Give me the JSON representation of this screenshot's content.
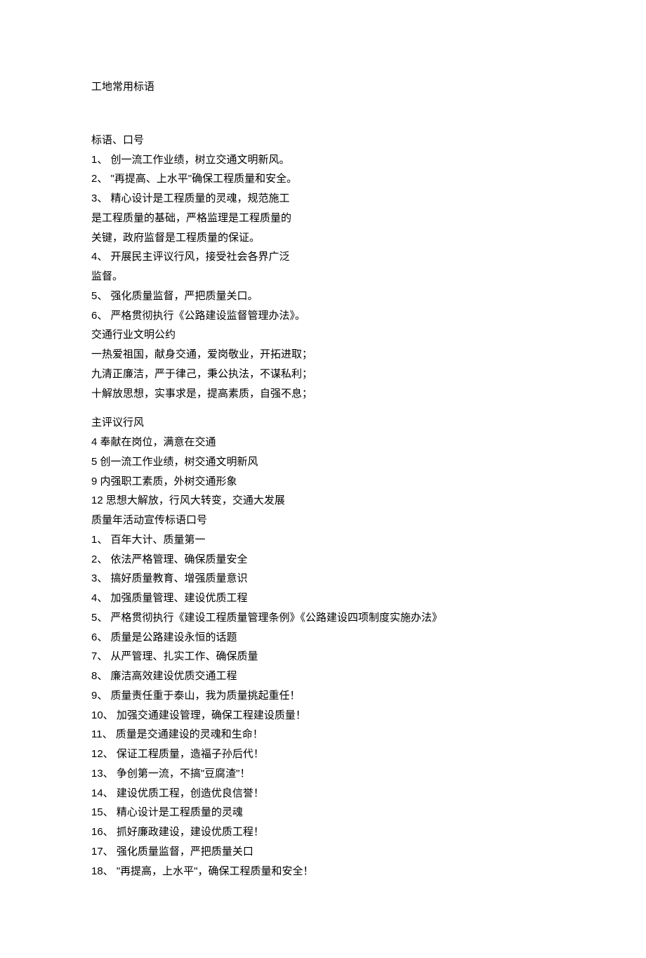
{
  "title": "工地常用标语",
  "section1": {
    "heading": "标语、口号",
    "items": [
      "1、  创一流工作业绩，树立交通文明新风。",
      "2、  \"再提高、上水平\"确保工程质量和安全。",
      "3、  精心设计是工程质量的灵魂，规范施工",
      "是工程质量的基础，严格监理是工程质量的",
      "关键，政府监督是工程质量的保证。",
      "4、  开展民主评议行风，接受社会各界广泛",
      "监督。",
      "5、  强化质量监督，严把质量关口。",
      "6、  严格贯彻执行《公路建设监督管理办法》。"
    ]
  },
  "section2": {
    "heading": "交通行业文明公约",
    "items": [
      "一热爱祖国，献身交通，爱岗敬业，开拓进取；",
      "九清正廉洁，严于律己，秉公执法，不谋私利；",
      "十解放思想，实事求是，提高素质，自强不息；"
    ]
  },
  "section3": {
    "heading": "主评议行风",
    "items": [
      "4 奉献在岗位，满意在交通",
      "5 创一流工作业绩，树交通文明新风",
      "9 内强职工素质，外树交通形象",
      "12 思想大解放，行风大转变，交通大发展"
    ]
  },
  "section4": {
    "heading": "质量年活动宣传标语口号",
    "items": [
      "1、  百年大计、质量第一",
      "2、  依法严格管理、确保质量安全",
      "3、  搞好质量教育、增强质量意识",
      "4、  加强质量管理、建设优质工程",
      "5、  严格贯彻执行《建设工程质量管理条例》《公路建设四项制度实施办法》",
      "6、  质量是公路建设永恒的话题",
      "7、  从严管理、扎实工作、确保质量",
      "8、  廉洁高效建设优质交通工程",
      "9、  质量责任重于泰山，我为质量挑起重任！",
      "10、  加强交通建设管理，确保工程建设质量！",
      "11、  质量是交通建设的灵魂和生命！",
      "12、  保证工程质量，造福子孙后代！",
      "13、  争创第一流，不搞\"豆腐渣\"！",
      "14、  建设优质工程，创造优良信誉！",
      "15、  精心设计是工程质量的灵魂",
      "16、  抓好廉政建设，建设优质工程！",
      "17、  强化质量监督，严把质量关口",
      "18、  \"再提高，上水平\"，确保工程质量和安全！"
    ]
  }
}
